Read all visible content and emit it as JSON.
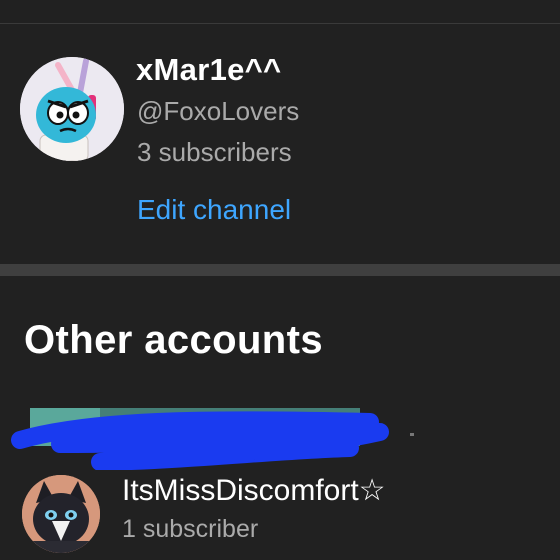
{
  "current_account": {
    "name": "xMar1e^^",
    "handle": "@FoxoLovers",
    "subscribers": "3 subscribers",
    "edit_label": "Edit channel"
  },
  "other_accounts": {
    "title": "Other accounts",
    "items": [
      {
        "name": "ItsMissDiscomfort☆",
        "subscribers": "1 subscriber"
      }
    ]
  },
  "colors": {
    "background": "#212121",
    "link": "#3ea6ff",
    "secondary_text": "#aaaaaa",
    "scribble": "#1a3bf0"
  }
}
